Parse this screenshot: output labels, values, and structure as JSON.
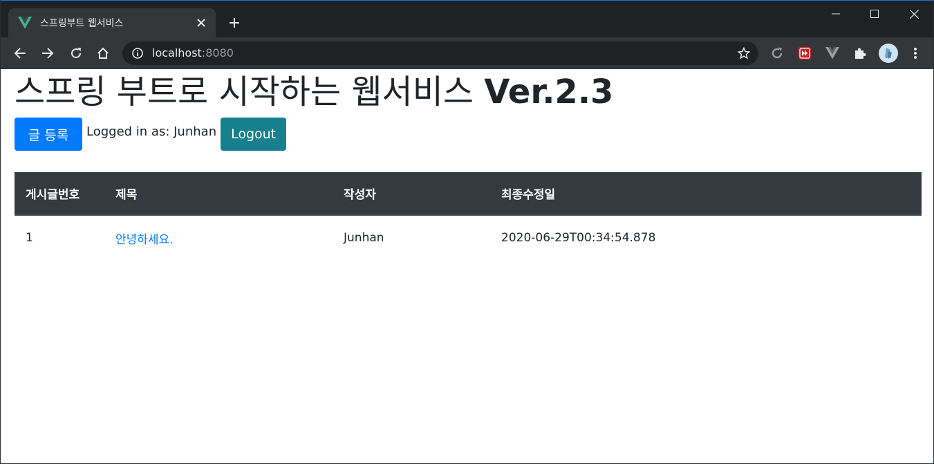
{
  "browser": {
    "tab_title": "스프링부트 웹서비스",
    "url_host": "localhost",
    "url_port": ":8080"
  },
  "colors": {
    "primary": "#007bff",
    "info": "#17808e",
    "table_header": "#343a40",
    "text": "#212529",
    "browser_frame": "#202124",
    "browser_toolbar": "#35363a"
  },
  "icons": {
    "tab_favicon": "vue-logo-icon",
    "tab_close": "close-icon",
    "new_tab": "plus-icon",
    "back": "arrow-left-icon",
    "forward": "arrow-right-icon",
    "reload": "reload-icon",
    "home": "home-icon",
    "site_info": "info-icon",
    "bookmark": "star-icon",
    "ext1": "refresh-extension-icon",
    "ext2": "red-extension-icon",
    "ext3": "vue-devtools-icon",
    "extensions": "puzzle-icon",
    "menu": "kebab-menu-icon"
  },
  "page": {
    "title_main": "스프링 부트로 시작하는 웹서비스 ",
    "title_version": "Ver.2.3",
    "register_button": "글 등록",
    "login_prefix": "Logged in as: ",
    "user_name": "Junhan",
    "logout_button": "Logout"
  },
  "table": {
    "headers": [
      "게시글번호",
      "제목",
      "작성자",
      "최종수정일"
    ],
    "rows": [
      {
        "id": "1",
        "title": "안녕하세요.",
        "author": "Junhan",
        "modified": "2020-06-29T00:34:54.878"
      }
    ]
  }
}
